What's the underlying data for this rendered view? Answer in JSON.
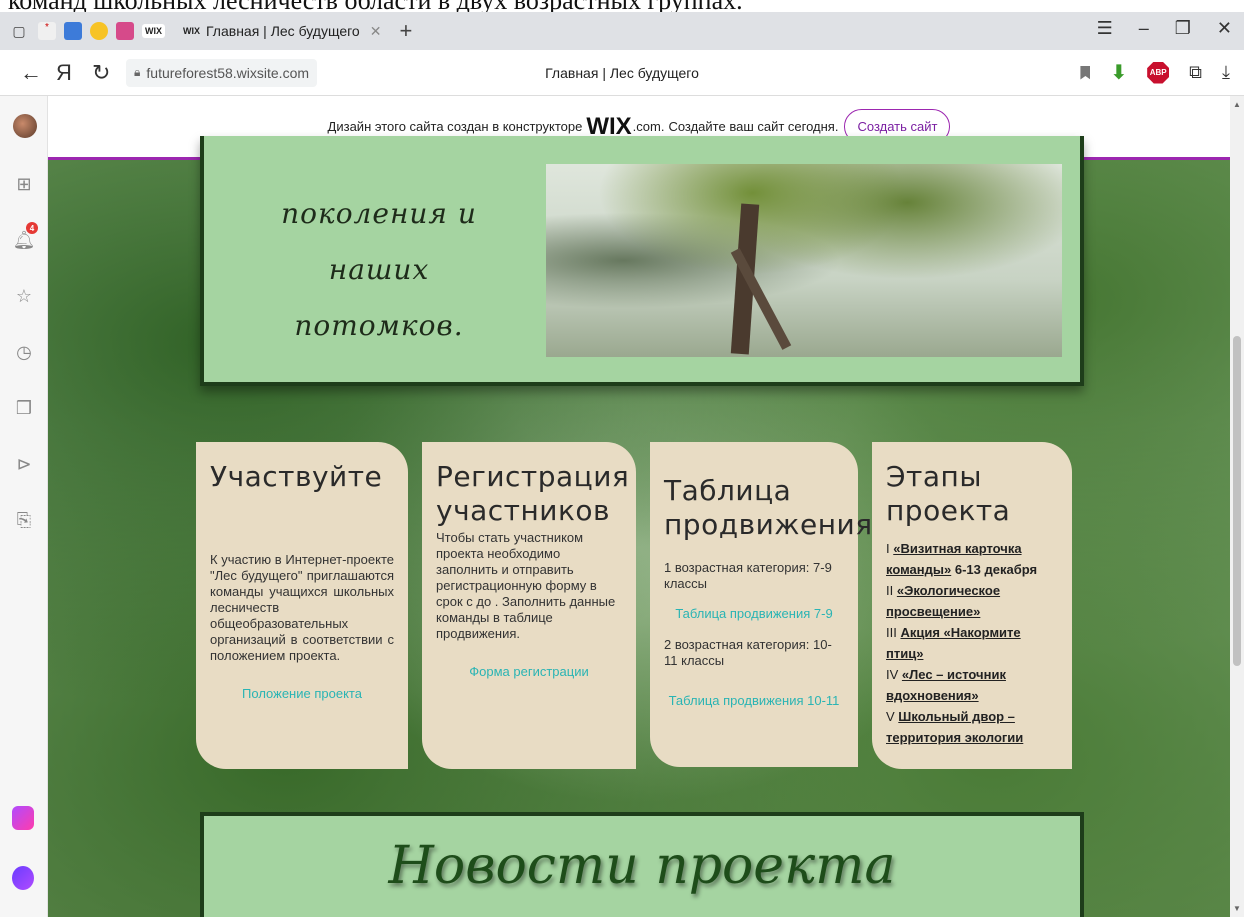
{
  "doc_strip": "команд школьных лесничеств области в двух возрастных группах.",
  "browser": {
    "tab_title": "Главная | Лес будущего",
    "tab_wix_icon": "WIX",
    "url": "futureforest58.wixsite.com",
    "page_title": "Главная | Лес будущего",
    "yandex_letter": "Я",
    "abp_label": "ABP",
    "notification_count": "4"
  },
  "wix_banner": {
    "text_before": "Дизайн этого сайта создан в конструкторе",
    "logo": "WIX",
    "domain": ".com.",
    "text_after": "Создайте ваш сайт сегодня.",
    "button": "Создать сайт"
  },
  "top_box": {
    "text_line1": "поколения и наших",
    "text_line2": "потомков."
  },
  "cards": [
    {
      "title": "Участвуйте",
      "body": "К участию в Интернет-проекте \"Лес будущего\" приглашаются команды учащихся школьных лесничеств общеобразовательных организаций в соответствии с положением проекта.",
      "link": "Положение проекта"
    },
    {
      "title": "Регистрация участников",
      "body": "Чтобы стать участником проекта необходимо заполнить и отправить регистрационную форму в срок с до . Заполнить данные команды в таблице продвижения.",
      "link": "Форма регистрации"
    },
    {
      "title": "Таблица продвижения",
      "cat1": "1 возрастная категория: 7-9 классы",
      "link1": "Таблица продвижения 7-9",
      "cat2": "2 возрастная категория: 10-11 классы",
      "link2": "Таблица продвижения 10-11"
    },
    {
      "title": "Этапы проекта",
      "stages": [
        {
          "num": "I",
          "name": "«Визитная карточка команды»",
          "extra": "6-13 декабря"
        },
        {
          "num": "II",
          "name": "«Экологическое просвещение»",
          "extra": ""
        },
        {
          "num": "III",
          "name": "Акция «Накормите птиц»",
          "extra": ""
        },
        {
          "num": "IV",
          "name": "«Лес – источник вдохновения»",
          "extra": ""
        },
        {
          "num": "V",
          "name": "Школьный двор – территория экологии",
          "extra": ""
        }
      ]
    }
  ],
  "news": {
    "title": "Новости проекта"
  }
}
